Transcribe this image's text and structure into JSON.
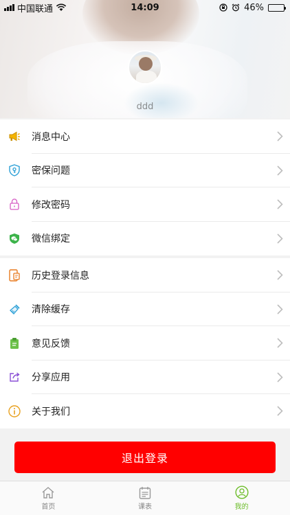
{
  "status_bar": {
    "carrier": "中国联通",
    "time": "14:09",
    "battery": "46%",
    "battery_level": 0.46
  },
  "profile": {
    "username": "ddd"
  },
  "menu_group_1": [
    {
      "label": "消息中心",
      "icon": "megaphone-icon",
      "color": "#f0a800"
    },
    {
      "label": "密保问题",
      "icon": "shield-key-icon",
      "color": "#2a9fd6"
    },
    {
      "label": "修改密码",
      "icon": "lock-icon",
      "color": "#d65cc4"
    },
    {
      "label": "微信绑定",
      "icon": "wechat-shield-icon",
      "color": "#3cb34a"
    }
  ],
  "menu_group_2": [
    {
      "label": "历史登录信息",
      "icon": "history-device-icon",
      "color": "#e87a1e"
    },
    {
      "label": "清除缓存",
      "icon": "broom-icon",
      "color": "#2a9fd6"
    },
    {
      "label": "意见反馈",
      "icon": "feedback-icon",
      "color": "#3cb34a"
    },
    {
      "label": "分享应用",
      "icon": "share-icon",
      "color": "#8a4fd6"
    },
    {
      "label": "关于我们",
      "icon": "info-icon",
      "color": "#e8a01e"
    }
  ],
  "logout_label": "退出登录",
  "logout_color": "#ff0000",
  "tabs": [
    {
      "label": "首页",
      "icon": "home-icon",
      "active": false
    },
    {
      "label": "课表",
      "icon": "timetable-icon",
      "active": false
    },
    {
      "label": "我的",
      "icon": "profile-icon",
      "active": true
    }
  ],
  "accent_color": "#6dbd2a"
}
